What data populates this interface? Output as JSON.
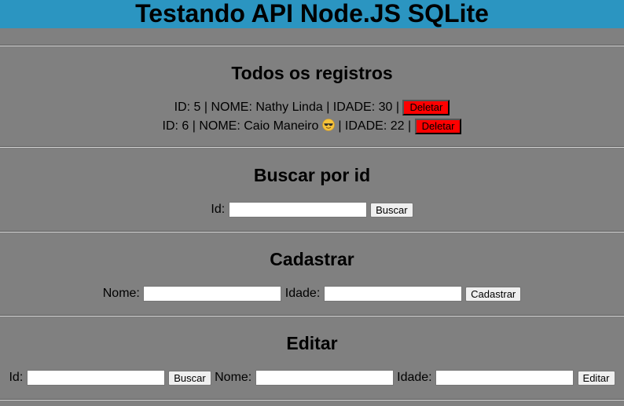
{
  "header": {
    "title": "Testando API Node.JS SQLite"
  },
  "all_records": {
    "title": "Todos os registros",
    "records": [
      {
        "text": "ID: 5 | NOME: Nathy Linda | IDADE: 30 |",
        "delete_label": "Deletar"
      },
      {
        "text_before_emoji": "ID: 6 | NOME: Caio Maneiro",
        "emoji": "sunglasses-face-icon",
        "text_after_emoji": "| IDADE: 22 |",
        "delete_label": "Deletar"
      }
    ],
    "delete_color": "#ff0000"
  },
  "search_by_id": {
    "title": "Buscar por id",
    "id_label": "Id:",
    "id_value": "",
    "button_label": "Buscar"
  },
  "register": {
    "title": "Cadastrar",
    "name_label": "Nome:",
    "name_value": "",
    "age_label": "Idade:",
    "age_value": "",
    "button_label": "Cadastrar"
  },
  "edit": {
    "title": "Editar",
    "id_label": "Id:",
    "id_value": "",
    "search_button_label": "Buscar",
    "name_label": "Nome:",
    "name_value": "",
    "age_label": "Idade:",
    "age_value": "",
    "edit_button_label": "Editar"
  },
  "colors": {
    "header_bg": "#2b95c1",
    "page_bg": "#808080"
  }
}
